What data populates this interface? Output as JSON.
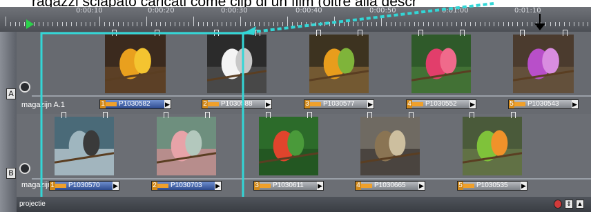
{
  "top_caption": "ragazzi sciapato caricati come clip di un film (oltre alla descr",
  "ruler": {
    "labels": [
      "0:00:10",
      "0:00:20",
      "0:00:30",
      "0:00:40",
      "0:00:50",
      "0:01:00",
      "0:01:10"
    ]
  },
  "tracks": [
    {
      "letter": "A",
      "name": "magazijn A.1"
    },
    {
      "letter": "B",
      "name": "magazijn B.1"
    }
  ],
  "clips_a": [
    {
      "num": "1",
      "name": "P1030582",
      "subject": "two orange parrots"
    },
    {
      "num": "2",
      "name": "P1030588",
      "subject": "white cockatoo"
    },
    {
      "num": "3",
      "name": "P1030577",
      "subject": "green yellow parrots"
    },
    {
      "num": "4",
      "name": "P1030552",
      "subject": "pink flower"
    },
    {
      "num": "5",
      "name": "P1030543",
      "subject": "purple orchids"
    }
  ],
  "clips_b": [
    {
      "num": "1",
      "name": "P1030570",
      "subject": "swan on water"
    },
    {
      "num": "2",
      "name": "P1030703",
      "subject": "flamingos"
    },
    {
      "num": "3",
      "name": "P1030611",
      "subject": "scarlet ibis"
    },
    {
      "num": "4",
      "name": "P1030665",
      "subject": "owl"
    },
    {
      "num": "5",
      "name": "P1030535",
      "subject": "lovebirds"
    }
  ],
  "status_label": "projectie",
  "colors": {
    "highlight": "#33d6d6",
    "ruler_bg": "#5c5f65",
    "track_bg": "#676a70"
  }
}
